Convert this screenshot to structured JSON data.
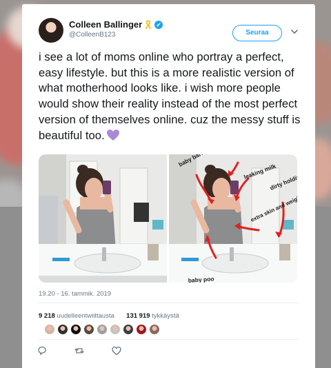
{
  "author": {
    "name": "Colleen Ballinger",
    "handle": "@ColleenB123",
    "verified_mark": "✔"
  },
  "follow_button": "Seuraa",
  "tweet": {
    "text": "i see a lot of moms online who portray a perfect, easy lifestyle. but this is a more realistic version of what motherhood looks like. i wish more people would show their reality instead of the most perfect version of themselves online. cuz the messy stuff is beautiful too.",
    "emoji": "purple-heart-icon"
  },
  "photo": {
    "annotations": [
      "baby barf",
      "leaking milk",
      "dirty holding dishes",
      "extra skin and weight from pregnancy",
      "baby poo"
    ]
  },
  "timestamp": "19.20 - 16. tammik. 2019",
  "stats": {
    "retweets_count": "9 218",
    "retweets_label": "uudelleentwiittausta",
    "likes_count": "131 919",
    "likes_label": "tykkäystä"
  },
  "liker_avatars": [
    "#d9b4a4",
    "#2f2f2f",
    "#111111",
    "#5b4a3c",
    "#9aa1a6",
    "#c8c2bd",
    "#3d3d3d",
    "#a3161e",
    "#8a6a5e"
  ],
  "colors": {
    "accent": "#1da1f2",
    "text": "#14171a",
    "muted": "#657786",
    "annotation_red": "#e0201e"
  },
  "icons": [
    "reply-icon",
    "retweet-icon",
    "like-icon",
    "chevron-down-icon",
    "yellow-ribbon-icon",
    "verified-badge-icon"
  ]
}
